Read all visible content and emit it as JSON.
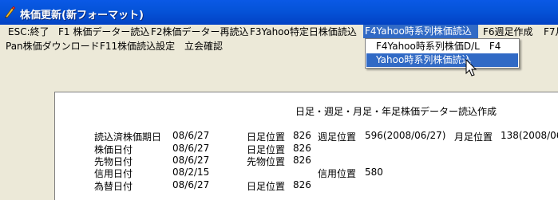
{
  "window": {
    "title": "株価更新(新フォーマット)"
  },
  "menubar": {
    "row1": [
      {
        "label": "ESC:終了",
        "active": false
      },
      {
        "label": "F1 株価データー読込",
        "active": false
      },
      {
        "label": "F2株価データー再読込",
        "active": false
      },
      {
        "label": "F3Yahoo特定日株価読込",
        "active": false
      },
      {
        "label": "F4Yahoo時系列株価読込",
        "active": true
      },
      {
        "label": "F6週足作成",
        "active": false
      },
      {
        "label": "F7月",
        "active": false
      }
    ],
    "row2": [
      {
        "label": "Pan株価ダウンロード"
      },
      {
        "label": "F11株価読込設定"
      },
      {
        "label": "立会確認"
      }
    ]
  },
  "dropdown": {
    "items": [
      {
        "label": "F4Yahoo時系列株価D/L　F4",
        "selected": false
      },
      {
        "label": "Yahoo時系列株価読込",
        "selected": true
      }
    ]
  },
  "report": {
    "title": "日足・週足・月足・年足株価データー読込作成",
    "rows": [
      {
        "label": "読込済株価期日",
        "date": "08/6/27",
        "pos1_label": "日足位置",
        "pos1_value": "826",
        "pos2_label": "週足位置",
        "pos2_value": "596(2008/06/27)",
        "pos3_label": "月足位置",
        "pos3_value": "138(2008/06"
      },
      {
        "label": "株価日付",
        "date": "08/6/27",
        "pos1_label": "日足位置",
        "pos1_value": "826"
      },
      {
        "label": "先物日付",
        "date": "08/6/27",
        "pos1_label": "先物位置",
        "pos1_value": "826"
      },
      {
        "label": "信用日付",
        "date": "08/2/15",
        "pos2_label": "信用位置",
        "pos2_value": "580"
      },
      {
        "label": "為替日付",
        "date": "08/6/27",
        "pos1_label": "日足位置",
        "pos1_value": "826"
      }
    ]
  }
}
